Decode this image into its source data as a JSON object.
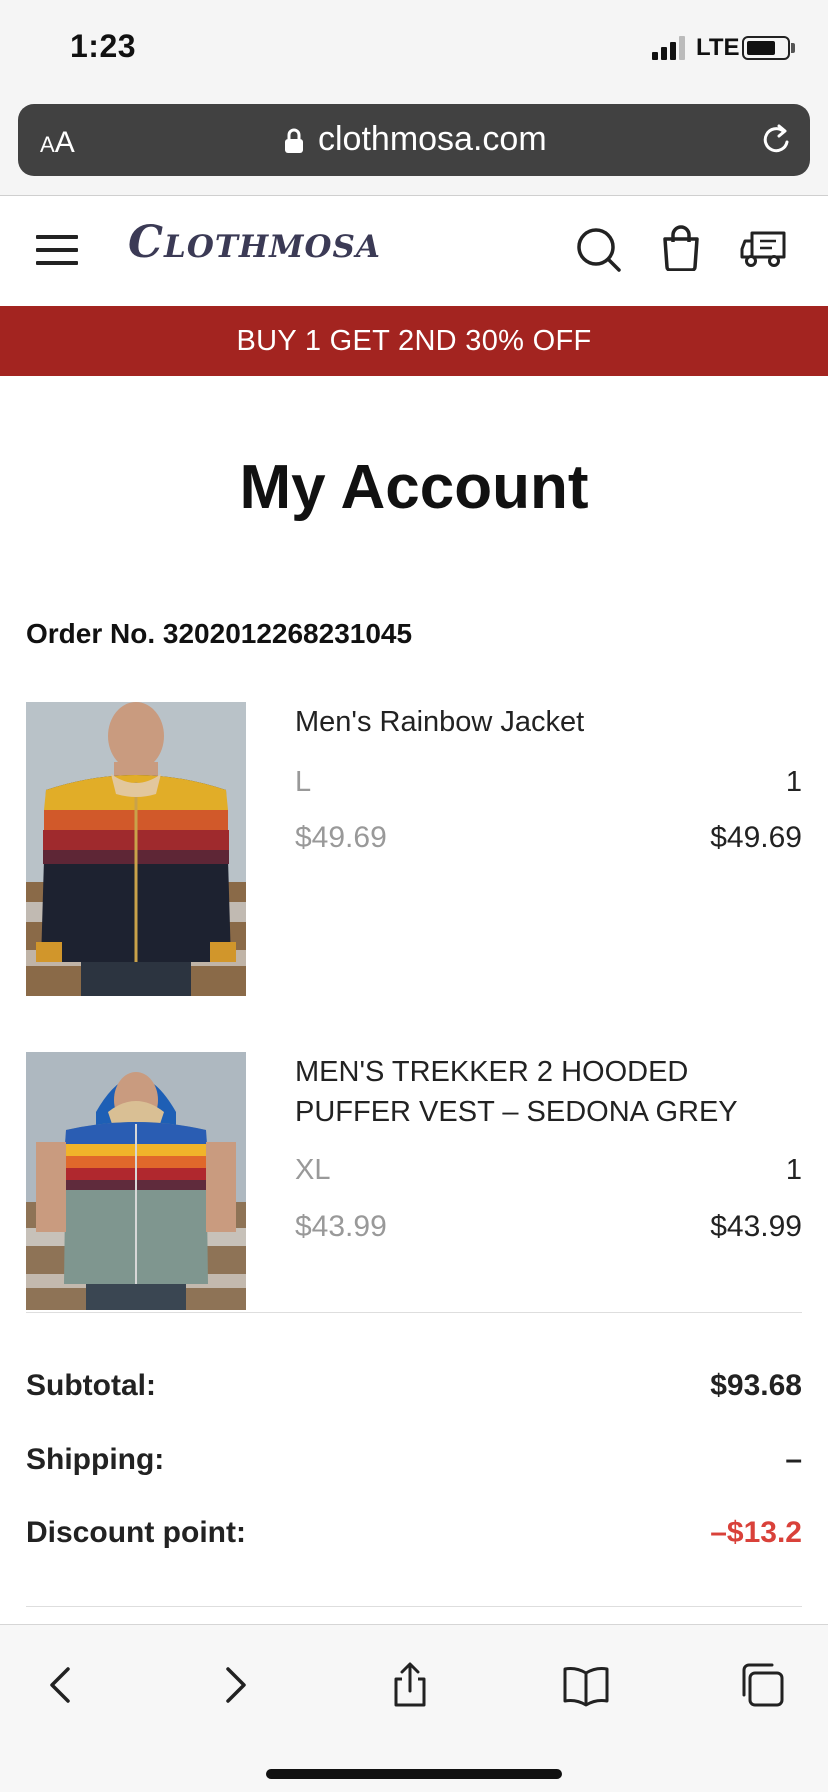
{
  "status_bar": {
    "time": "1:23",
    "network": "LTE"
  },
  "browser": {
    "text_size_label_small": "A",
    "text_size_label_large": "A",
    "url": "clothmosa.com"
  },
  "site": {
    "logo_text": "Clothmosa",
    "promo_banner": "BUY 1 GET 2ND 30% OFF"
  },
  "page": {
    "title": "My Account",
    "order_number": "Order No. 3202012268231045"
  },
  "items": [
    {
      "name": "Men's Rainbow Jacket",
      "size": "L",
      "quantity": "1",
      "unit_price": "$49.69",
      "line_total": "$49.69"
    },
    {
      "name": "MEN'S TREKKER 2 HOODED PUFFER VEST – SEDONA GREY",
      "size": "XL",
      "quantity": "1",
      "unit_price": "$43.99",
      "line_total": "$43.99"
    }
  ],
  "summary": {
    "subtotal_label": "Subtotal:",
    "subtotal_value": "$93.68",
    "shipping_label": "Shipping:",
    "shipping_value": "–",
    "discount_label": "Discount point:",
    "discount_value": "–$13.2"
  },
  "colors": {
    "promo_banner": "#a32420",
    "discount_text": "#d9413a",
    "logo": "#3b3a55"
  },
  "icons": {
    "browser": [
      "lock-icon",
      "reload-icon"
    ],
    "header": [
      "menu-icon",
      "search-icon",
      "shopping-bag-icon",
      "delivery-truck-icon"
    ],
    "toolbar": [
      "back-icon",
      "forward-icon",
      "share-icon",
      "bookmarks-icon",
      "tabs-icon"
    ]
  }
}
